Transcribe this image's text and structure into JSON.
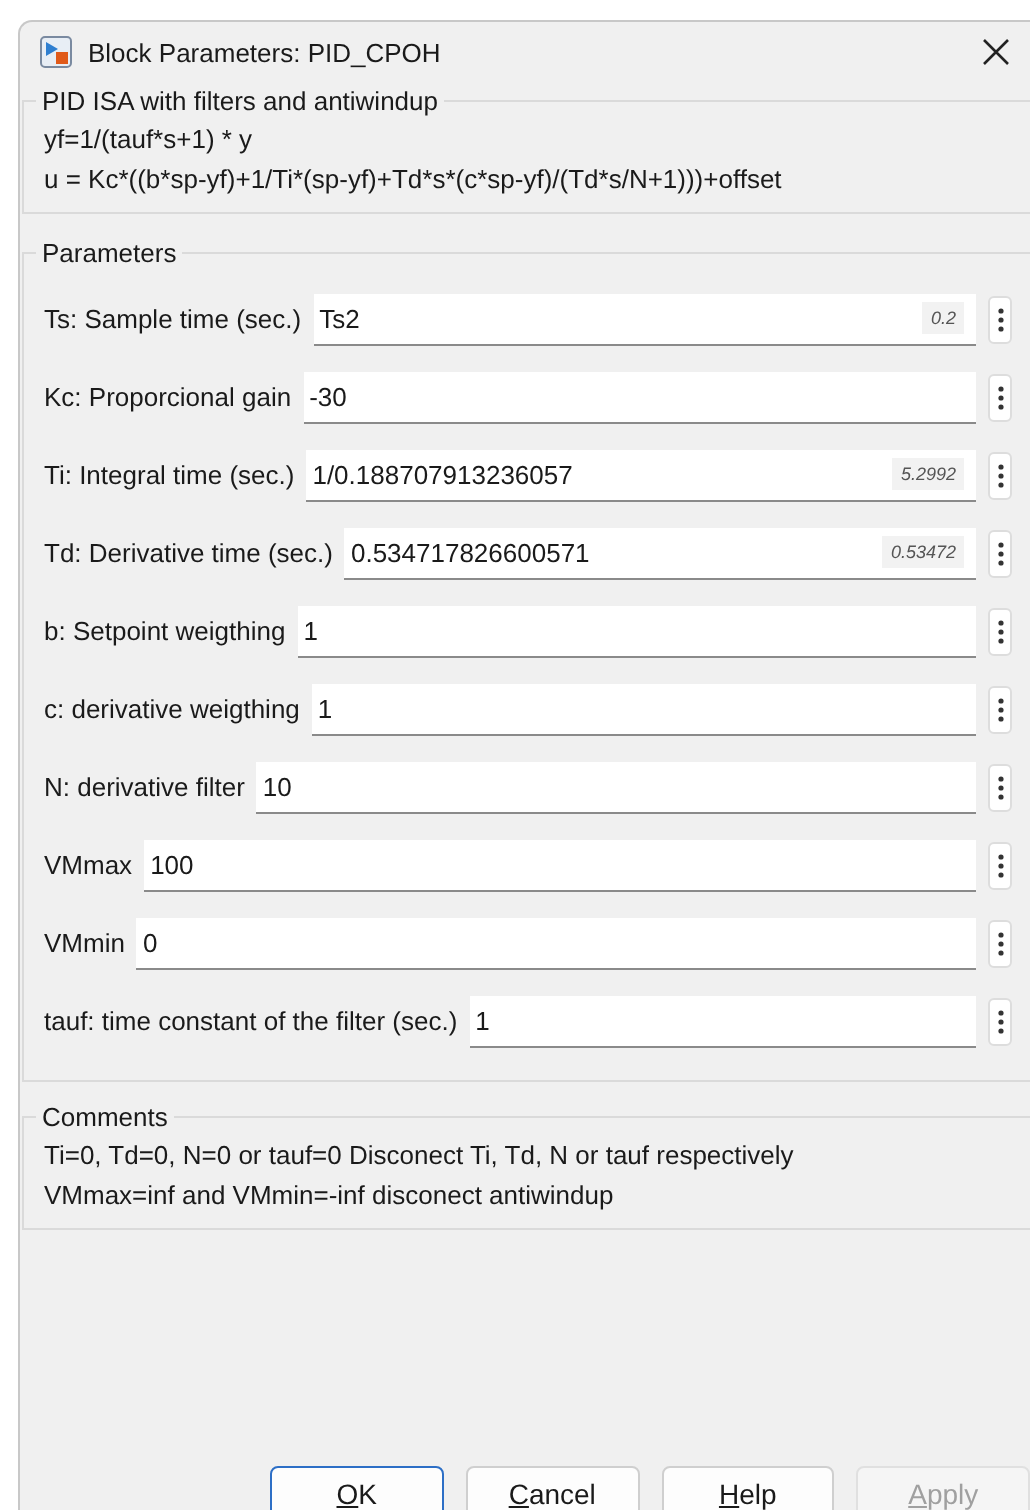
{
  "window": {
    "title": "Block Parameters: PID_CPOH"
  },
  "description": {
    "title": "PID ISA with filters and antiwindup",
    "lines": [
      "yf=1/(tauf*s+1) * y",
      "u = Kc*((b*sp-yf)+1/Ti*(sp-yf)+Td*s*(c*sp-yf)/(Td*s/N+1)))+offset"
    ]
  },
  "parameters": {
    "title": "Parameters",
    "rows": [
      {
        "label": "Ts: Sample time (sec.)",
        "value": "Ts2",
        "evaluated": "0.2"
      },
      {
        "label": "Kc: Proporcional gain",
        "value": "-30"
      },
      {
        "label": "Ti: Integral time (sec.)",
        "value": "1/0.188707913236057",
        "evaluated": "5.2992"
      },
      {
        "label": "Td: Derivative time (sec.)",
        "value": "0.534717826600571",
        "evaluated": "0.53472"
      },
      {
        "label": "b: Setpoint weigthing",
        "value": "1"
      },
      {
        "label": "c: derivative weigthing",
        "value": "1"
      },
      {
        "label": "N: derivative filter",
        "value": "10"
      },
      {
        "label": "VMmax",
        "value": "100"
      },
      {
        "label": "VMmin",
        "value": "0"
      },
      {
        "label": "tauf: time constant of the filter (sec.)",
        "value": "1"
      }
    ]
  },
  "comments": {
    "title": "Comments",
    "lines": [
      "Ti=0, Td=0, N=0 or tauf=0 Disconect Ti, Td, N or tauf respectively",
      "VMmax=inf and VMmin=-inf disconect antiwindup"
    ]
  },
  "buttons": [
    {
      "label": "OK",
      "default": true,
      "disabled": false
    },
    {
      "label": "Cancel",
      "default": false,
      "disabled": false
    },
    {
      "label": "Help",
      "default": false,
      "disabled": false
    },
    {
      "label": "Apply",
      "default": false,
      "disabled": true
    }
  ]
}
